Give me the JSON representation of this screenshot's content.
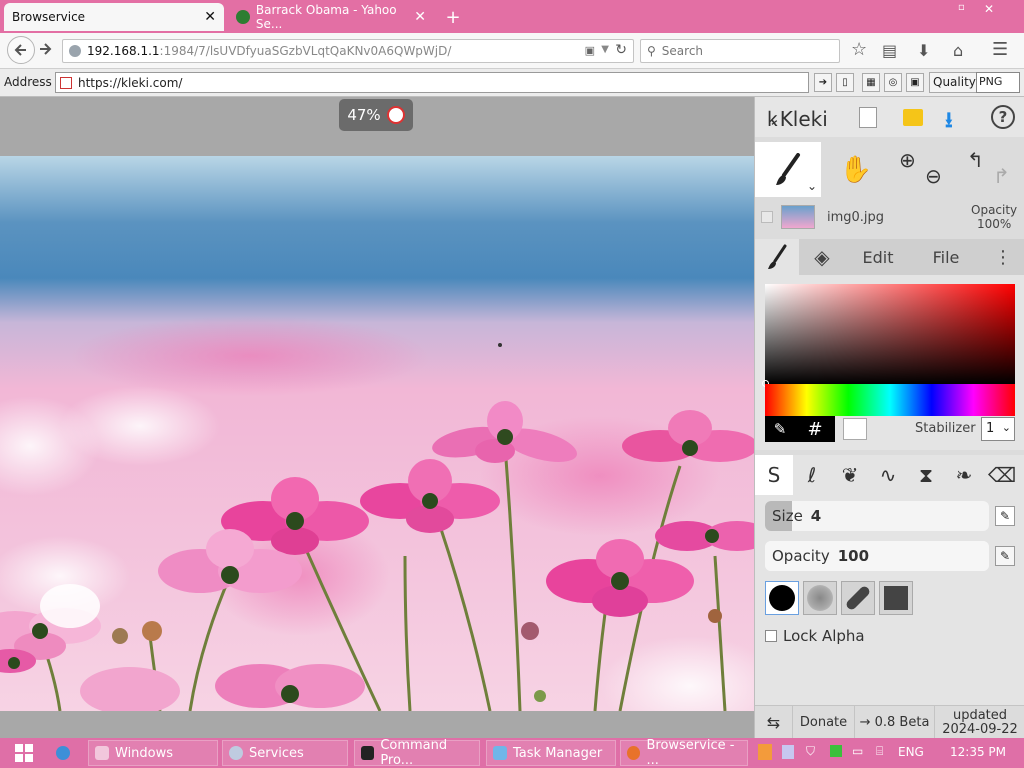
{
  "browser": {
    "tabs": [
      {
        "label": "Browservice",
        "active": true
      },
      {
        "label": "Barrack Obama - Yahoo Se...",
        "active": false
      }
    ],
    "new_tab": "+",
    "url_host": "192.168.1.1",
    "url_path": ":1984/7/lsUVDfyuaSGzbVLqtQaKNv0A6QWpWjD/",
    "search_placeholder": "Search",
    "window_controls": {
      "minimize": "−",
      "close": "✕"
    }
  },
  "addressbar": {
    "label": "Address",
    "url": "https://kleki.com/",
    "quality_label": "Quality",
    "format": "PNG"
  },
  "canvas": {
    "zoom": "47%"
  },
  "kleki": {
    "logo": "Kleki",
    "layer_name": "img0.jpg",
    "opacity_label": "Opacity",
    "opacity_value": "100%",
    "tabs": {
      "edit": "Edit",
      "file": "File"
    },
    "hex_symbol": "#",
    "stabilizer_label": "Stabilizer",
    "stabilizer_value": "1",
    "size_label": "Size",
    "size_value": "4",
    "size_fraction": 0.12,
    "opacity_slider_label": "Opacity",
    "opacity_slider_value": "100",
    "opacity_fraction": 1.0,
    "lock_alpha": "Lock Alpha",
    "footer": {
      "donate": "Donate",
      "version": "→ 0.8 Beta",
      "updated_label": "updated",
      "updated_date": "2024-09-22"
    }
  },
  "taskbar": {
    "items": [
      {
        "label": "Windows"
      },
      {
        "label": "Services"
      },
      {
        "label": "Command Pro..."
      },
      {
        "label": "Task Manager"
      },
      {
        "label": "Browservice - ..."
      }
    ],
    "lang": "ENG",
    "clock": "12:35 PM"
  },
  "colors": {
    "tabbar": "#e36fa4",
    "taskbar": "#df6fa7",
    "download_blue": "#1e88e5",
    "folder_yellow": "#f5c518"
  }
}
